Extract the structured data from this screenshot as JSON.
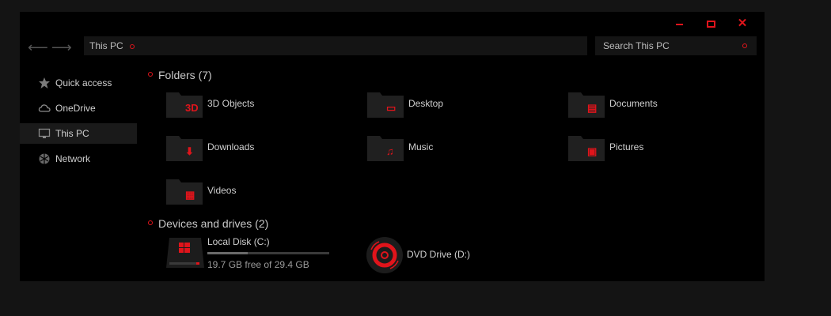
{
  "toolbar": {
    "address": "This PC",
    "search_placeholder": "Search This PC"
  },
  "sidebar": {
    "items": [
      {
        "label": "Quick access",
        "icon": "star-icon"
      },
      {
        "label": "OneDrive",
        "icon": "cloud-icon"
      },
      {
        "label": "This PC",
        "icon": "monitor-icon",
        "active": true
      },
      {
        "label": "Network",
        "icon": "network-icon"
      }
    ]
  },
  "folders": {
    "title": "Folders (7)",
    "items": [
      {
        "label": "3D Objects",
        "icon": "3d-objects-icon",
        "glyph": "3D"
      },
      {
        "label": "Desktop",
        "icon": "desktop-icon",
        "glyph": "▭"
      },
      {
        "label": "Documents",
        "icon": "document-icon",
        "glyph": "▤"
      },
      {
        "label": "Downloads",
        "icon": "download-arrow-icon",
        "glyph": "⬇"
      },
      {
        "label": "Music",
        "icon": "music-note-icon",
        "glyph": "♫"
      },
      {
        "label": "Pictures",
        "icon": "picture-icon",
        "glyph": "▣"
      },
      {
        "label": "Videos",
        "icon": "film-icon",
        "glyph": "▦"
      }
    ]
  },
  "drives": {
    "title": "Devices and drives (2)",
    "items": [
      {
        "label": "Local Disk (C:)",
        "free_text": "19.7 GB free of 29.4 GB",
        "used_fraction": 0.33,
        "icon": "windows-drive-icon"
      },
      {
        "label": "DVD Drive (D:)",
        "icon": "dvd-disc-icon"
      }
    ]
  },
  "colors": {
    "accent": "#e0141b",
    "window_bg": "#000000",
    "page_bg": "#141414"
  }
}
